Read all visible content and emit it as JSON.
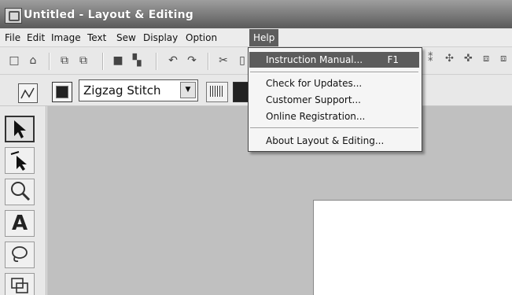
{
  "window": {
    "title": "Untitled - Layout & Editing"
  },
  "menubar": {
    "items": [
      "File",
      "Edit",
      "Image",
      "Text",
      "Sew",
      "Display",
      "Option",
      "Help"
    ],
    "active": "Help"
  },
  "help_menu": {
    "items": [
      {
        "label": "Instruction Manual...",
        "shortcut": "F1"
      },
      {
        "label": "Check for Updates..."
      },
      {
        "label": "Customer Support..."
      },
      {
        "label": "Online Registration..."
      },
      {
        "label": "About Layout & Editing..."
      }
    ]
  },
  "stitch_toolbar": {
    "stitch_type": "Zigzag Stitch"
  },
  "tools": [
    "select-tool",
    "point-edit-tool",
    "zoom-tool",
    "text-tool",
    "lasso-tool",
    "shape-tool"
  ]
}
